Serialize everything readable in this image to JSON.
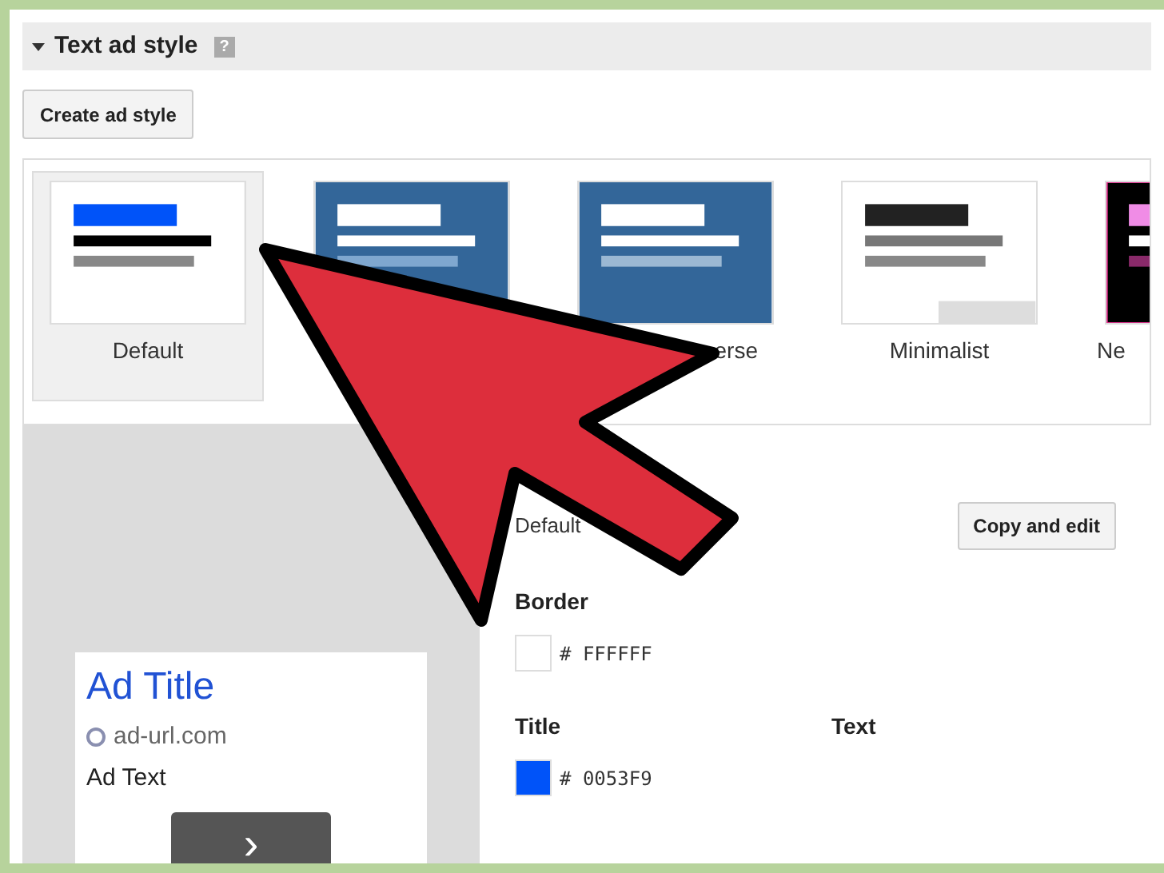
{
  "section": {
    "title": "Text ad style",
    "expanded": true,
    "help": "?"
  },
  "create_button": "Create ad style",
  "styles": [
    {
      "label": "Default",
      "selected": true,
      "kind": "default"
    },
    {
      "kind": "blue"
    },
    {
      "label": "erse",
      "selected": false,
      "kind": "inverse"
    },
    {
      "label": "Minimalist",
      "selected": false,
      "kind": "minimalist"
    },
    {
      "label": "Ne",
      "selected": false,
      "kind": "neon"
    }
  ],
  "preview": {
    "title": "Ad Title",
    "url": "ad-url.com",
    "text": "Ad Text",
    "action": "›"
  },
  "details": {
    "name": "Default",
    "copy_button": "Copy and edit",
    "fields": [
      {
        "label": "Border",
        "color": "#ffffff",
        "value": "# FFFFFF"
      },
      {
        "label": "Title",
        "color": "#0053f9",
        "value": "# 0053F9"
      },
      {
        "label": "Text"
      }
    ]
  }
}
